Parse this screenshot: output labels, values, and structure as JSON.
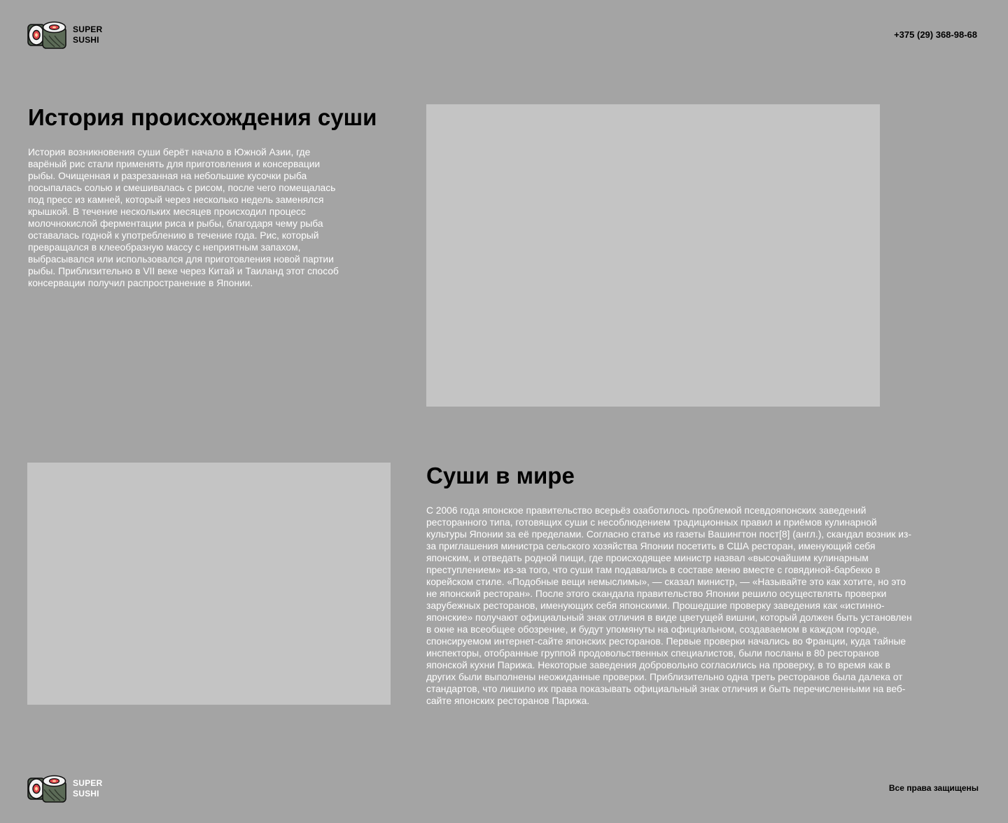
{
  "header": {
    "logo": {
      "icon": "sushi-rolls-icon",
      "line1": "SUPER",
      "line2": "SUSHI"
    },
    "phone": "+375 (29) 368-98-68"
  },
  "sections": [
    {
      "title": "История происхождения суши",
      "text": "История возникновения суши берёт начало в Южной Азии, где варёный рис стали применять для приготовления и консервации рыбы. Очищенная и разрезанная на небольшие кусочки рыба посыпалась солью и смешивалась с рисом, после чего помещалась под пресс из камней, который через несколько недель заменялся крышкой. В течение нескольких месяцев происходил процесс молочнокислой ферментации риса и рыбы, благодаря чему рыба оставалась годной к употреблению в течение года. Рис, который превращался в клееобразную массу с неприятным запахом, выбрасывался или использовался для приготовления новой партии рыбы. Приблизительно в VII веке через Китай и Таиланд этот способ консервации получил распространение в Японии."
    },
    {
      "title": "Суши в мире",
      "text": "С 2006 года японское правительство всерьёз озаботилось проблемой псевдояпонских заведений ресторанного типа, готовящих суши с несоблюдением традиционных правил и приёмов кулинарной культуры Японии за её пределами. Согласно статье из газеты Вашингтон пост[8] (англ.), скандал возник из-за приглашения министра сельского хозяйства Японии посетить в США ресторан, именующий себя японским, и отведать родной пищи, где происходящее министр назвал «высочайшим кулинарным преступлением» из-за того, что суши там подавались в составе меню вместе с говядиной-барбекю в корейском стиле. «Подобные вещи немыслимы», — сказал министр, — «Называйте это как хотите, но это не японский ресторан». После этого скандала правительство Японии решило осуществлять проверки зарубежных ресторанов, именующих себя японскими. Прошедшие проверку заведения как «истинно-японские» получают официальный знак отличия в виде цветущей вишни, который должен быть установлен в окне на всеобщее обозрение, и будут упомянуты на официальном, создаваемом в каждом городе, спонсируемом интернет-сайте японских ресторанов. Первые проверки начались во Франции, куда тайные инспекторы, отобранные группой продовольственных специалистов, были посланы в 80 ресторанов японской кухни Парижа. Некоторые заведения добровольно согласились на проверку, в то время как в других были выполнены неожиданные проверки. Приблизительно одна треть ресторанов была далека от стандартов, что лишило их права показывать официальный знак отличия и быть перечисленными на веб-сайте японских ресторанов Парижа."
    }
  ],
  "footer": {
    "logo": {
      "icon": "sushi-rolls-icon",
      "line1": "SUPER",
      "line2": "SUSHI"
    },
    "rights": "Все права защищены"
  },
  "colors": {
    "background": "#a4a4a4",
    "image_placeholder": "#c4c4c4",
    "heading": "#000000",
    "body_text": "#ffffff"
  }
}
